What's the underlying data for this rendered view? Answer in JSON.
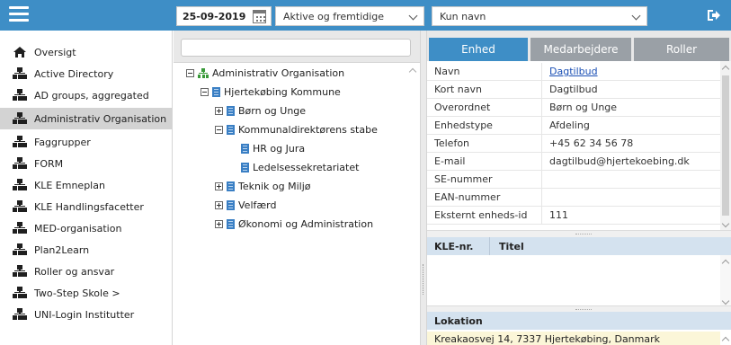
{
  "topbar": {
    "date": "25-09-2019",
    "filter_selected": "Aktive og fremtidige",
    "view_selected": "Kun navn"
  },
  "leftnav": {
    "items": [
      {
        "label": "Oversigt",
        "icon": "home-icon"
      },
      {
        "label": "Active Directory",
        "icon": "org-chart-icon"
      },
      {
        "label": "AD groups, aggregated",
        "icon": "org-chart-icon"
      },
      {
        "label": "Administrativ Organisation",
        "icon": "org-chart-icon",
        "active": true
      },
      {
        "label": "Faggrupper",
        "icon": "org-chart-icon"
      },
      {
        "label": "FORM",
        "icon": "org-chart-icon"
      },
      {
        "label": "KLE Emneplan",
        "icon": "org-chart-icon"
      },
      {
        "label": "KLE Handlingsfacetter",
        "icon": "org-chart-icon"
      },
      {
        "label": "MED-organisation",
        "icon": "org-chart-icon"
      },
      {
        "label": "Plan2Learn",
        "icon": "org-chart-icon"
      },
      {
        "label": "Roller og ansvar",
        "icon": "org-chart-icon"
      },
      {
        "label": "Two-Step Skole >",
        "icon": "org-chart-icon"
      },
      {
        "label": "UNI-Login Institutter",
        "icon": "org-chart-icon"
      }
    ]
  },
  "tree": {
    "search_placeholder": "",
    "nodes": [
      {
        "label": "Administrativ Organisation",
        "level": 0,
        "toggle": "minus",
        "icon": "org"
      },
      {
        "label": "Hjertekøbing Kommune",
        "level": 1,
        "toggle": "minus",
        "icon": "building"
      },
      {
        "label": "Børn og Unge",
        "level": 2,
        "toggle": "plus",
        "icon": "building"
      },
      {
        "label": "Kommunaldirektørens stabe",
        "level": 2,
        "toggle": "minus",
        "icon": "building"
      },
      {
        "label": "HR og Jura",
        "level": 3,
        "toggle": "none",
        "icon": "building"
      },
      {
        "label": "Ledelsessekretariatet",
        "level": 3,
        "toggle": "none",
        "icon": "building"
      },
      {
        "label": "Teknik og Miljø",
        "level": 2,
        "toggle": "plus",
        "icon": "building"
      },
      {
        "label": "Velfærd",
        "level": 2,
        "toggle": "plus",
        "icon": "building"
      },
      {
        "label": "Økonomi og Administration",
        "level": 2,
        "toggle": "plus",
        "icon": "building"
      }
    ]
  },
  "tabs": [
    {
      "label": "Enhed",
      "active": true
    },
    {
      "label": "Medarbejdere",
      "active": false
    },
    {
      "label": "Roller",
      "active": false
    }
  ],
  "details": [
    {
      "label": "Navn",
      "value": "Dagtilbud",
      "link": true
    },
    {
      "label": "Kort navn",
      "value": "Dagtilbud"
    },
    {
      "label": "Overordnet",
      "value": "Børn og Unge"
    },
    {
      "label": "Enhedstype",
      "value": "Afdeling"
    },
    {
      "label": "Telefon",
      "value": "+45 62 34 56 78"
    },
    {
      "label": "E-mail",
      "value": "dagtilbud@hjertekoebing.dk"
    },
    {
      "label": "SE-nummer",
      "value": ""
    },
    {
      "label": "EAN-nummer",
      "value": ""
    },
    {
      "label": "Eksternt enheds-id",
      "value": "111"
    }
  ],
  "kle": {
    "col1": "KLE-nr.",
    "col2": "Titel"
  },
  "lokation": {
    "header": "Lokation",
    "address": "Kreakaosvej 14, 7337 Hjertekøbing, Danmark"
  },
  "colors": {
    "accent": "#3e8ec6",
    "tab_inactive": "#9aa0a6",
    "active_nav": "#d3d3d3"
  }
}
